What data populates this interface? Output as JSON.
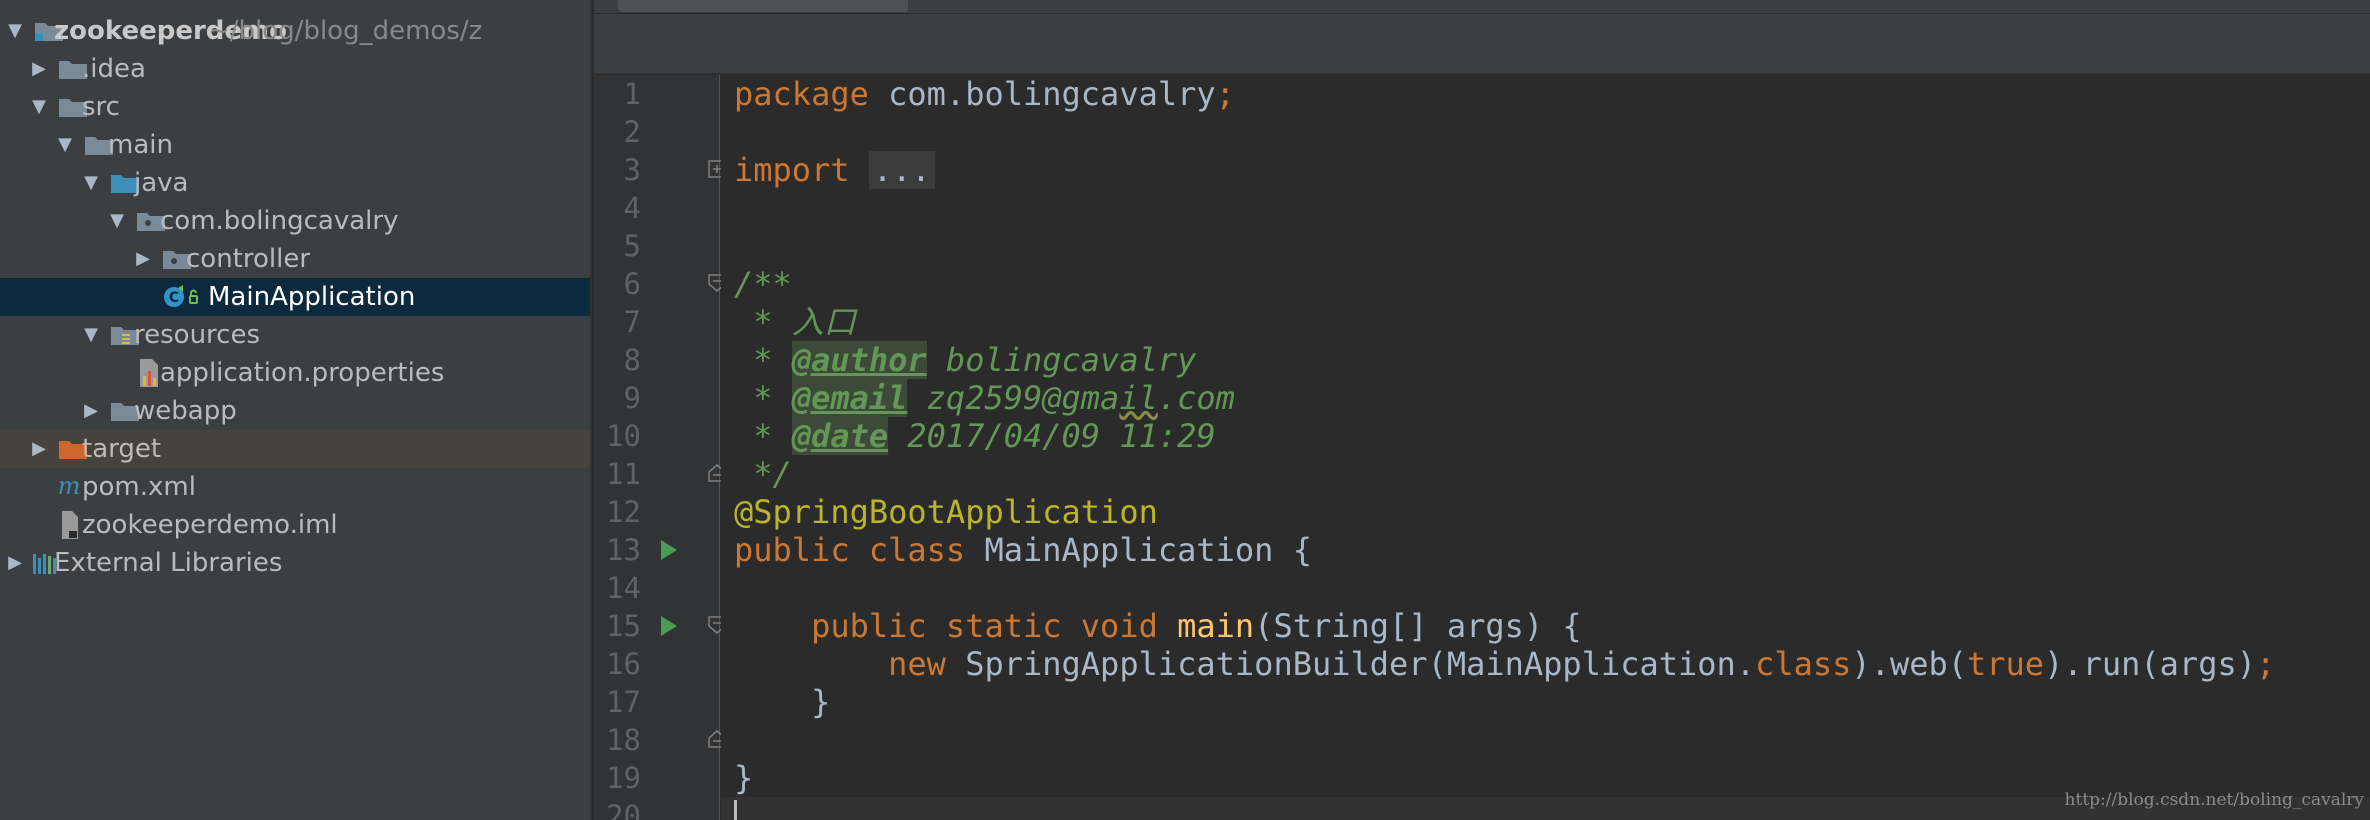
{
  "project_tree": {
    "root": {
      "name": "zookeeperdemo",
      "path": "~/blog/blog_demos/z"
    },
    "items": [
      {
        "label": ".idea"
      },
      {
        "label": "src"
      },
      {
        "label": "main"
      },
      {
        "label": "java"
      },
      {
        "label": "com.bolingcavalry"
      },
      {
        "label": "controller"
      },
      {
        "label": "MainApplication"
      },
      {
        "label": "resources"
      },
      {
        "label": "application.properties"
      },
      {
        "label": "webapp"
      },
      {
        "label": "target"
      },
      {
        "label": "pom.xml"
      },
      {
        "label": "zookeeperdemo.iml"
      },
      {
        "label": "External Libraries"
      }
    ]
  },
  "editor": {
    "line_numbers": [
      "1",
      "2",
      "3",
      "4",
      "5",
      "6",
      "7",
      "8",
      "9",
      "10",
      "11",
      "12",
      "13",
      "14",
      "15",
      "16",
      "17",
      "18",
      "19",
      "20"
    ],
    "code": {
      "l1": {
        "kw": "package",
        "pkg": " com.bolingcavalry",
        "semi": ";"
      },
      "l3": {
        "kw": "import",
        "folded": "..."
      },
      "l6": "/**",
      "l7": " * 入口",
      "l8": {
        "pre": " * ",
        "tag": "@author",
        "text": " bolingcavalry"
      },
      "l9": {
        "pre": " * ",
        "tag": "@email",
        "text_a": " zq2599@gma",
        "text_err": "il",
        "text_b": ".com"
      },
      "l10": {
        "pre": " * ",
        "tag": "@date",
        "text": " 2017/04/09 11:29"
      },
      "l11": " */",
      "l12": "@SpringBootApplication",
      "l13": {
        "kw": "public class",
        "name": " MainApplication {"
      },
      "l15": {
        "indent": "    ",
        "kw": "public static void",
        "fn": " main",
        "rest": "(String[] args) {"
      },
      "l16": {
        "indent": "        ",
        "kw_new": "new",
        "a": " SpringApplicationBuilder(MainApplication.",
        "kw_class": "class",
        "b": ").web(",
        "kw_true": "true",
        "c": ").run(args)",
        "semi": ";"
      },
      "l17": "    }",
      "l19": "}"
    }
  },
  "watermark": "http://blog.csdn.net/boling_cavalry",
  "colors": {
    "background": "#2b2b2b",
    "sidebar": "#3c3f41",
    "keyword": "#cc7832",
    "annotation": "#bbb529",
    "method": "#ffc66d",
    "doc_comment": "#629755",
    "selection": "#0d293e"
  }
}
